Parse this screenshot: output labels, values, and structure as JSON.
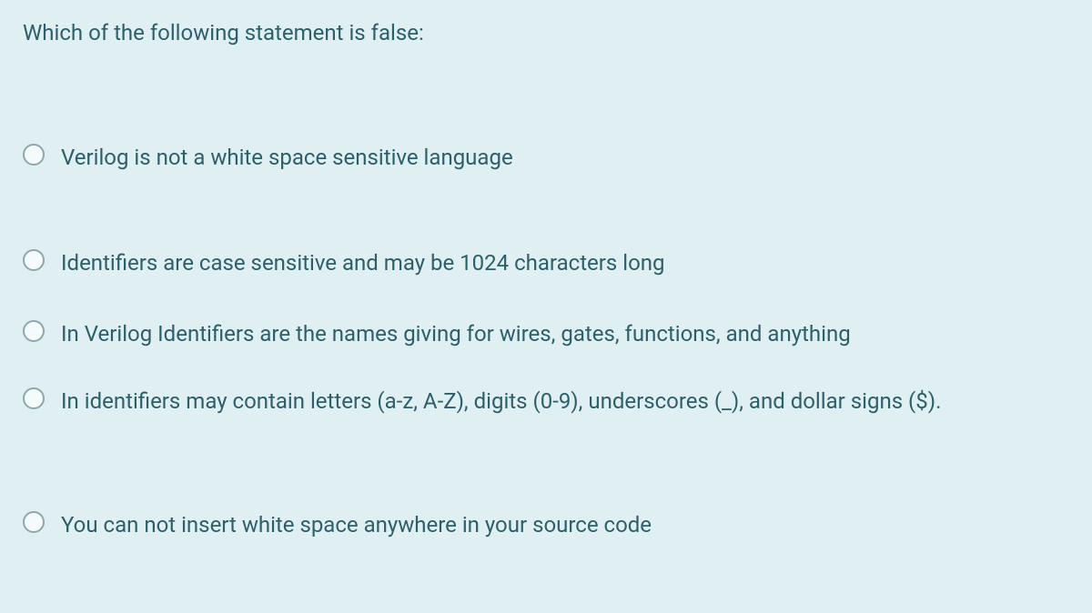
{
  "question": {
    "text": "Which of the following statement is false:"
  },
  "options": [
    {
      "label": "Verilog is not a white space sensitive language"
    },
    {
      "label": "Identifiers are case sensitive and may be 1024 characters long"
    },
    {
      "label": "In Verilog Identifiers are the names giving for wires, gates, functions, and anything"
    },
    {
      "label": "In identifiers may contain letters (a-z, A-Z), digits (0-9), underscores (_), and dollar signs ($)."
    },
    {
      "label": "You can not insert white space anywhere in your source code"
    }
  ]
}
